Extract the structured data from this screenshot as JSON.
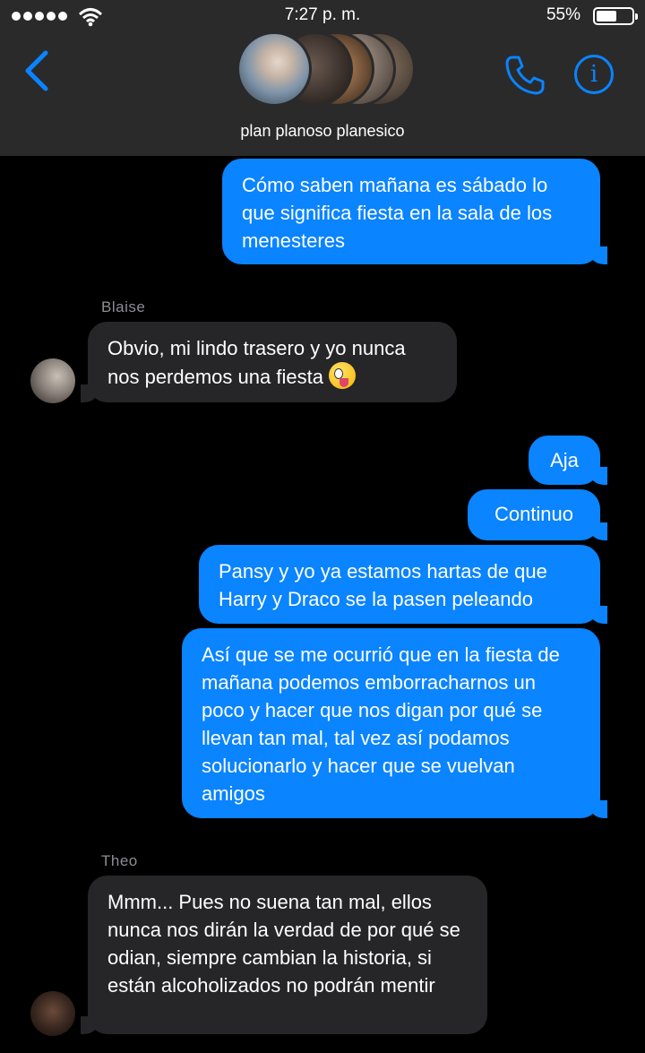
{
  "status_bar": {
    "time": "7:27 p. m.",
    "battery": "55%",
    "battery_level": 0.55
  },
  "header": {
    "group_name": "plan planoso planesico",
    "back_icon": "chevron-left-icon",
    "call_icon": "phone-icon",
    "info_icon": "info-icon",
    "info_glyph": "i",
    "accent_color": "#0a84ff"
  },
  "messages": [
    {
      "direction": "outgoing",
      "text": "Cómo saben mañana es sábado lo que significa fiesta en la sala de los menesteres"
    },
    {
      "direction": "incoming",
      "sender": "Blaise",
      "text": "Obvio, mi lindo trasero y yo nunca nos perdemos una fiesta",
      "emoji": "zany-face"
    },
    {
      "direction": "outgoing",
      "text": "Aja"
    },
    {
      "direction": "outgoing",
      "text": "Continuo"
    },
    {
      "direction": "outgoing",
      "text": "Pansy y yo ya estamos hartas de que Harry y Draco se la pasen peleando"
    },
    {
      "direction": "outgoing",
      "text": "Así que se me ocurrió que en la fiesta de mañana podemos emborracharnos un poco y hacer que nos digan por qué se llevan tan mal, tal vez así podamos solucionarlo y hacer que se vuelvan amigos"
    },
    {
      "direction": "incoming",
      "sender": "Theo",
      "text": "Mmm... Pues no suena tan mal, ellos nunca nos dirán la verdad de por qué se odian, siempre cambian la historia, si están alcoholizados no podrán mentir"
    }
  ]
}
